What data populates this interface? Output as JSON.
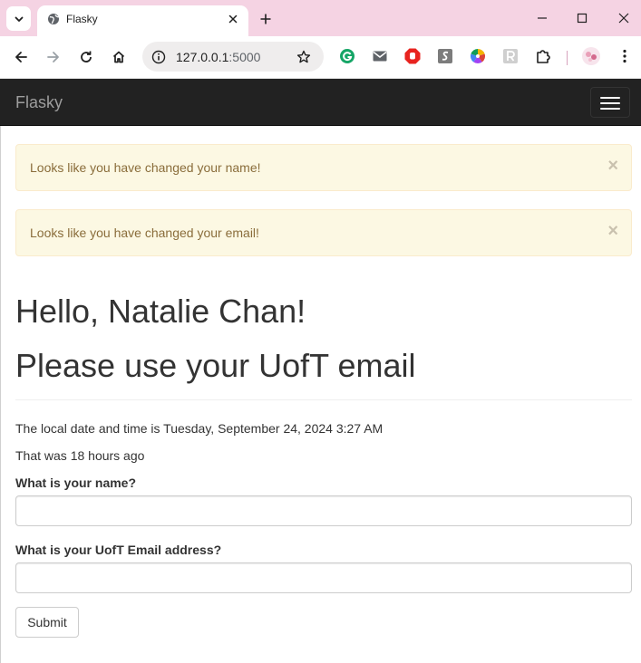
{
  "browser": {
    "tab": {
      "title": "Flasky"
    },
    "address": {
      "host": "127.0.0.1",
      "port": ":5000"
    }
  },
  "navbar": {
    "brand": "Flasky"
  },
  "alerts": [
    {
      "text": "Looks like you have changed your name!",
      "close": "×"
    },
    {
      "text": "Looks like you have changed your email!",
      "close": "×"
    }
  ],
  "greeting": "Hello, Natalie Chan!",
  "subheading": "Please use your UofT email",
  "datetime_text": "The local date and time is Tuesday, September 24, 2024 3:27 AM",
  "relative_time": "That was 18 hours ago",
  "form": {
    "name_label": "What is your name?",
    "name_value": "",
    "email_label": "What is your UofT Email address?",
    "email_value": "",
    "submit_label": "Submit"
  },
  "colors": {
    "tabstrip": "#f5d3e3",
    "navbar": "#222222",
    "alert_bg": "#fcf8e3",
    "alert_text": "#8a6d3b"
  }
}
